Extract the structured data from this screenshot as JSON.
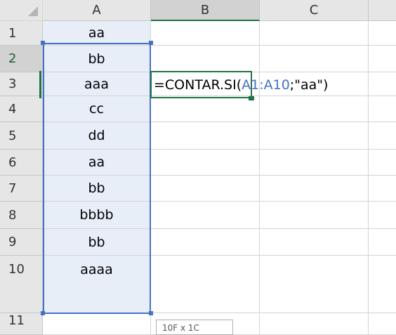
{
  "columns": [
    "A",
    "B",
    "C"
  ],
  "rows": [
    "1",
    "2",
    "3",
    "4",
    "5",
    "6",
    "7",
    "8",
    "9",
    "10",
    "11"
  ],
  "column_a_values": [
    "aa",
    "bb",
    "aaa",
    "cc",
    "dd",
    "aa",
    "bb",
    "bbbb",
    "bb",
    "aaaa"
  ],
  "active_cell": {
    "formula_prefix": "=CONTAR.SI(",
    "formula_ref": "A1:A10",
    "formula_suffix": ";\"aa\")"
  },
  "tooltip_text": "10F x 1C",
  "colors": {
    "selection_green": "#217346",
    "reference_blue": "#4472c4",
    "range_fill": "#e8eef8",
    "header_bg": "#e6e6e6"
  }
}
